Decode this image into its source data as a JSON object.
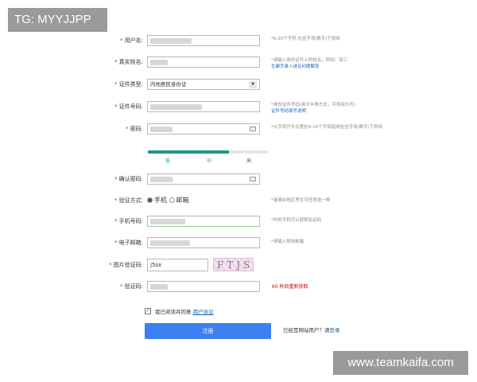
{
  "watermark_top": "TG: MYYJJPP",
  "watermark_bottom": "www.teamkaifa.com",
  "form": {
    "required_mark": "*",
    "username": {
      "label": "用户名:",
      "hint": "*6-20个字符,包含字母/数字/下划线"
    },
    "realname": {
      "label": "真实姓名:",
      "hint": "*请输入身份证件上的姓名，例如：张三",
      "hint_link": "生僻字录入请见问题解答"
    },
    "id_type": {
      "label": "证件类型:",
      "value": "内地居民身份证",
      "arrow": "▼"
    },
    "id_number": {
      "label": "证件号码:",
      "hint": "*身份证件号码(英文半角方式，字母用大写)",
      "hint_link": "证件号码填写说明"
    },
    "password": {
      "label": "密码:",
      "hint": "*以字母开头长度在6-16个字母组成包含字母/数字/下划线"
    },
    "strength": {
      "levels": [
        "低",
        "中",
        "高"
      ],
      "fill_fraction": 0.67
    },
    "confirm_password": {
      "label": "确认密码:"
    },
    "verify_method": {
      "label": "验证方式:",
      "options": [
        "手机",
        "邮箱"
      ],
      "selected": "手机",
      "hint": "*港澳台地区考生可任意选一种"
    },
    "phone": {
      "label": "手机号码:",
      "hint": "*内地手机可以获取验证码"
    },
    "email": {
      "label": "电子邮箱:",
      "hint": "*请输入常用邮箱"
    },
    "captcha_image": {
      "label": "图片验证码:",
      "value": "j5sx",
      "image_text": "FTJS"
    },
    "sms_code": {
      "label": "验证码:",
      "countdown": "60 秒后重新获取"
    },
    "agree": {
      "text": "我已阅读并同意",
      "link": "用户协议",
      "check": "✓"
    },
    "register_button": "注册",
    "login_prompt": "已经是网站用户？请",
    "login_link": "登录"
  }
}
